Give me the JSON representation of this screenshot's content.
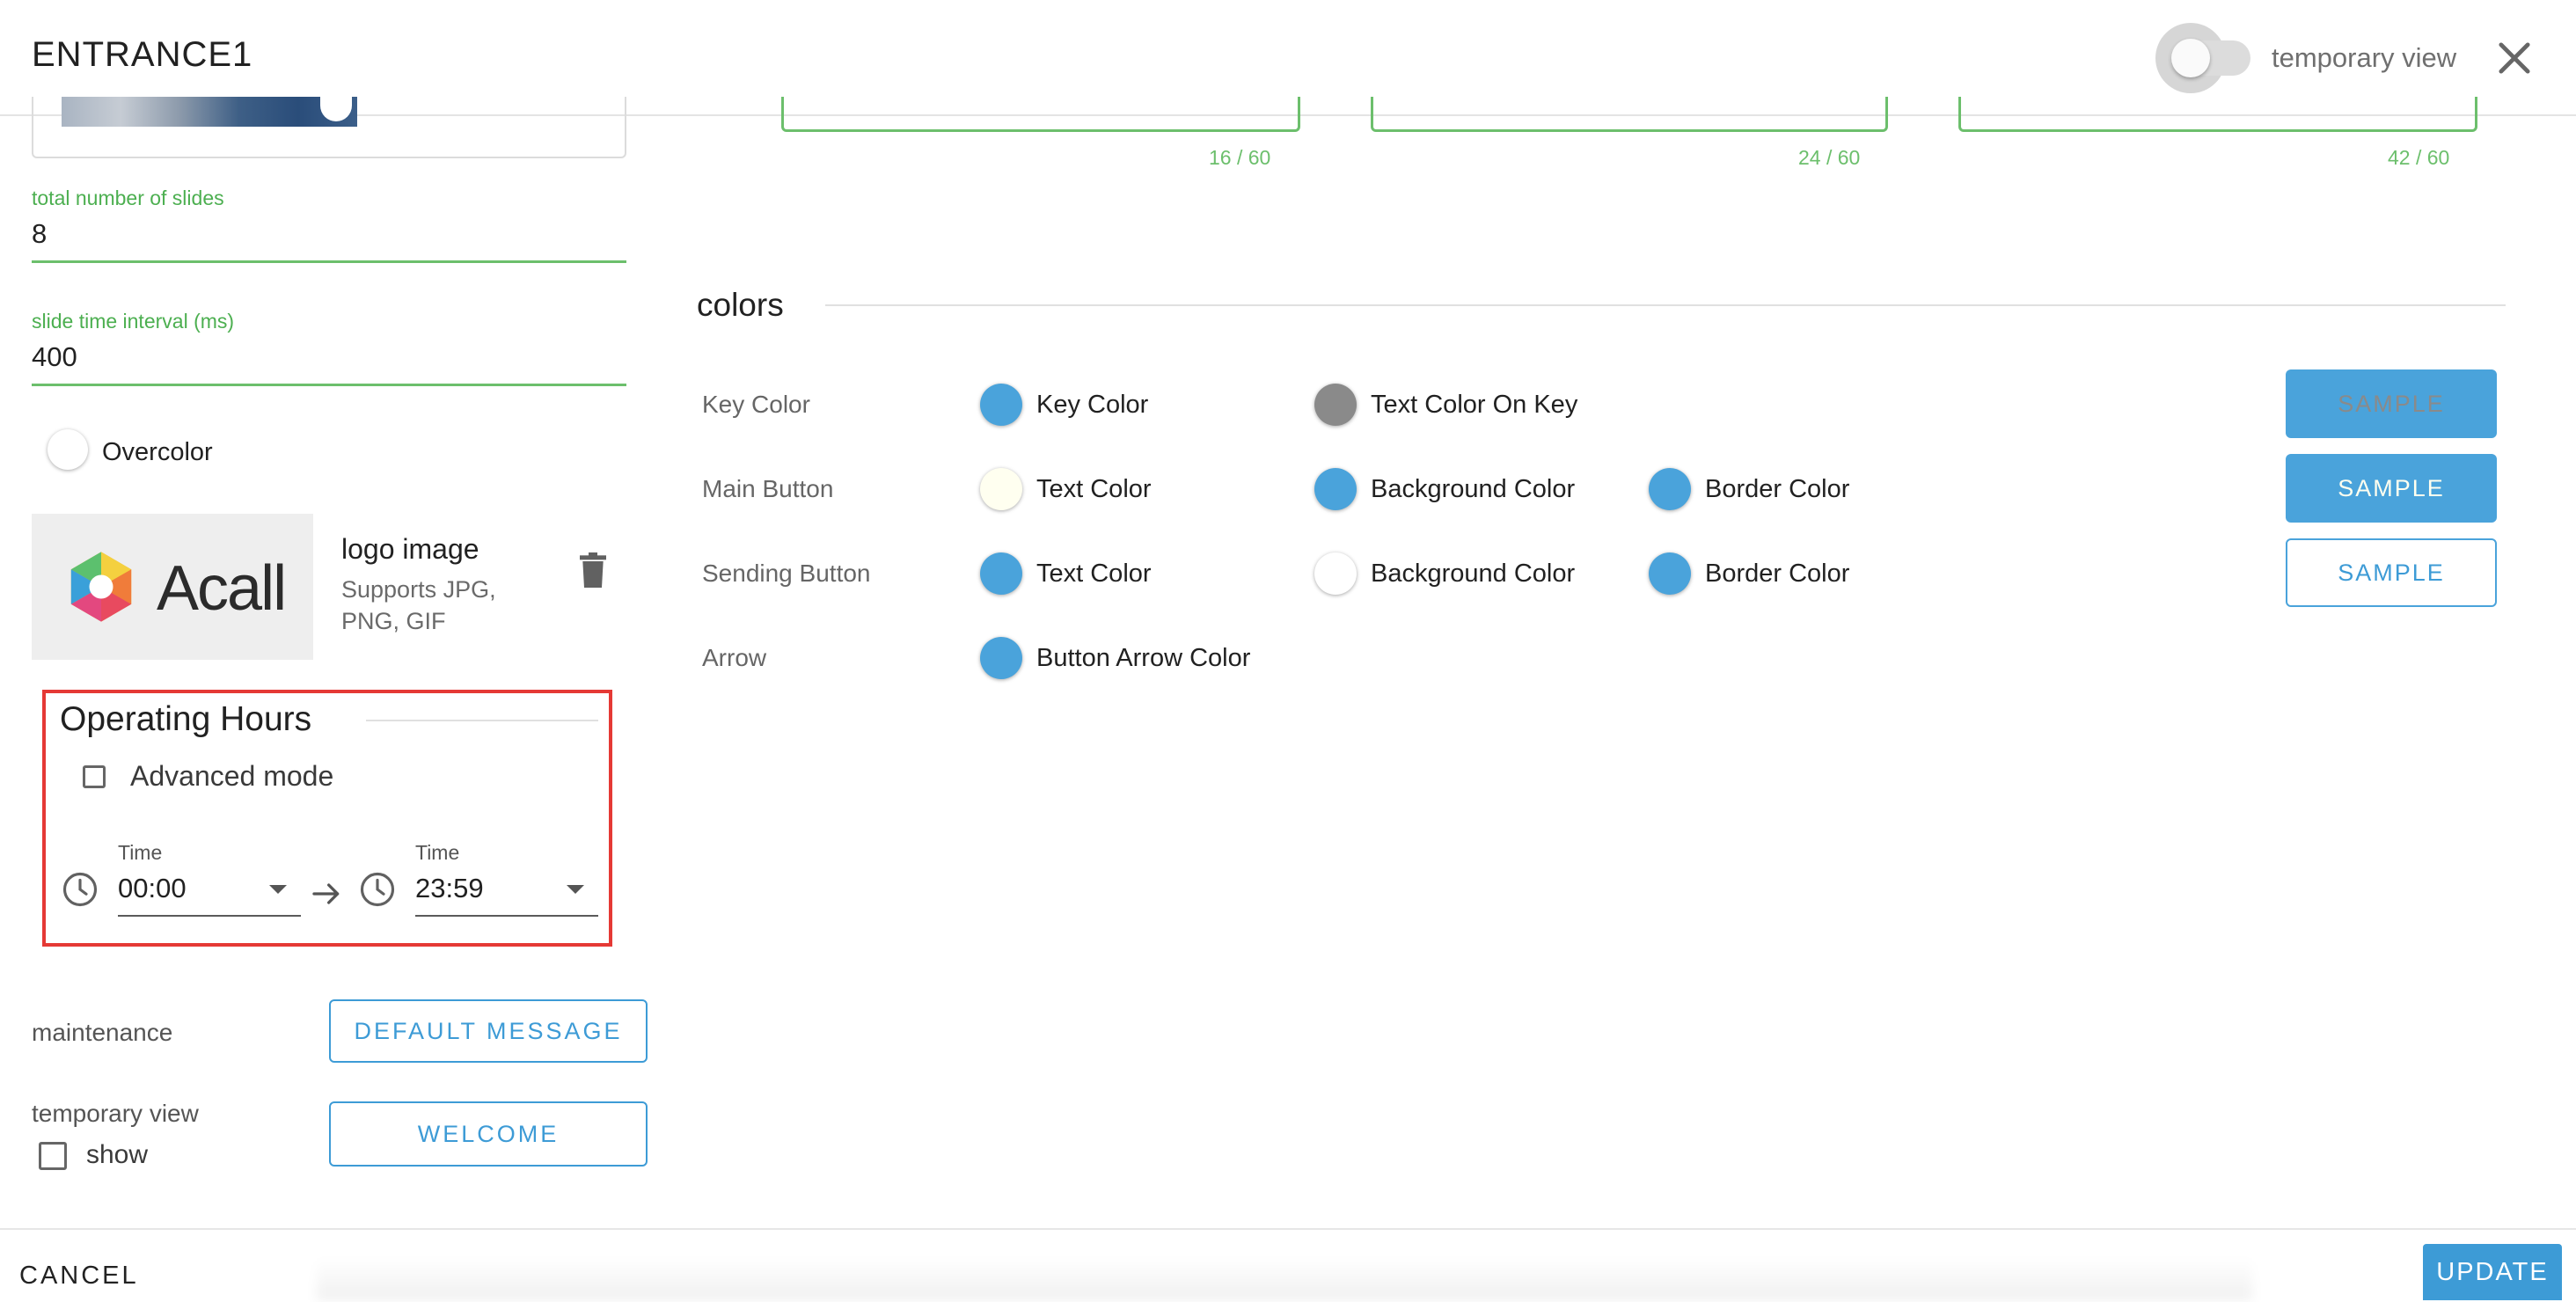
{
  "header": {
    "title": "ENTRANCE1",
    "temporary_view_label": "temporary view",
    "close_icon": "close-icon",
    "toggle_on": false
  },
  "left": {
    "total_slides": {
      "label": "total number of slides",
      "value": "8"
    },
    "slide_interval": {
      "label": "slide time interval (ms)",
      "value": "400"
    },
    "overcolor": {
      "label": "Overcolor",
      "color": "#ffffff"
    },
    "logo": {
      "brand_text": "Acall",
      "title": "logo image",
      "supports": "Supports JPG, PNG, GIF",
      "delete_icon": "trash-icon"
    },
    "operating_hours": {
      "title": "Operating Hours",
      "advanced_mode_label": "Advanced mode",
      "advanced_mode_checked": false,
      "start": {
        "label": "Time",
        "value": "00:00"
      },
      "end": {
        "label": "Time",
        "value": "23:59"
      }
    },
    "maintenance": {
      "label": "maintenance",
      "button": "DEFAULT MESSAGE"
    },
    "temporary_view": {
      "label": "temporary view",
      "show_label": "show",
      "show_checked": false,
      "button": "WELCOME"
    }
  },
  "textareas": [
    {
      "count": "16 / 60"
    },
    {
      "count": "24 / 60"
    },
    {
      "count": "42 / 60"
    }
  ],
  "colors": {
    "title": "colors",
    "rows": [
      {
        "label": "Key Color",
        "swatches": [
          {
            "label": "Key Color",
            "color": "#4aa3db"
          },
          {
            "label": "Text Color On Key",
            "color": "#8a8a8a"
          }
        ],
        "sample": "SAMPLE"
      },
      {
        "label": "Main Button",
        "swatches": [
          {
            "label": "Text Color",
            "color": "#fffff0"
          },
          {
            "label": "Background Color",
            "color": "#4aa3db"
          },
          {
            "label": "Border Color",
            "color": "#4aa3db"
          }
        ],
        "sample": "SAMPLE"
      },
      {
        "label": "Sending Button",
        "swatches": [
          {
            "label": "Text Color",
            "color": "#4aa3db"
          },
          {
            "label": "Background Color",
            "color": "#ffffff"
          },
          {
            "label": "Border Color",
            "color": "#4aa3db"
          }
        ],
        "sample": "SAMPLE"
      },
      {
        "label": "Arrow",
        "swatches": [
          {
            "label": "Button Arrow Color",
            "color": "#4aa3db"
          }
        ]
      }
    ]
  },
  "footer": {
    "cancel": "CANCEL",
    "update": "UPDATE"
  },
  "theme": {
    "accent": "#3d9bd6",
    "valid_green": "#6cbf6c",
    "highlight_red": "#e53935"
  }
}
